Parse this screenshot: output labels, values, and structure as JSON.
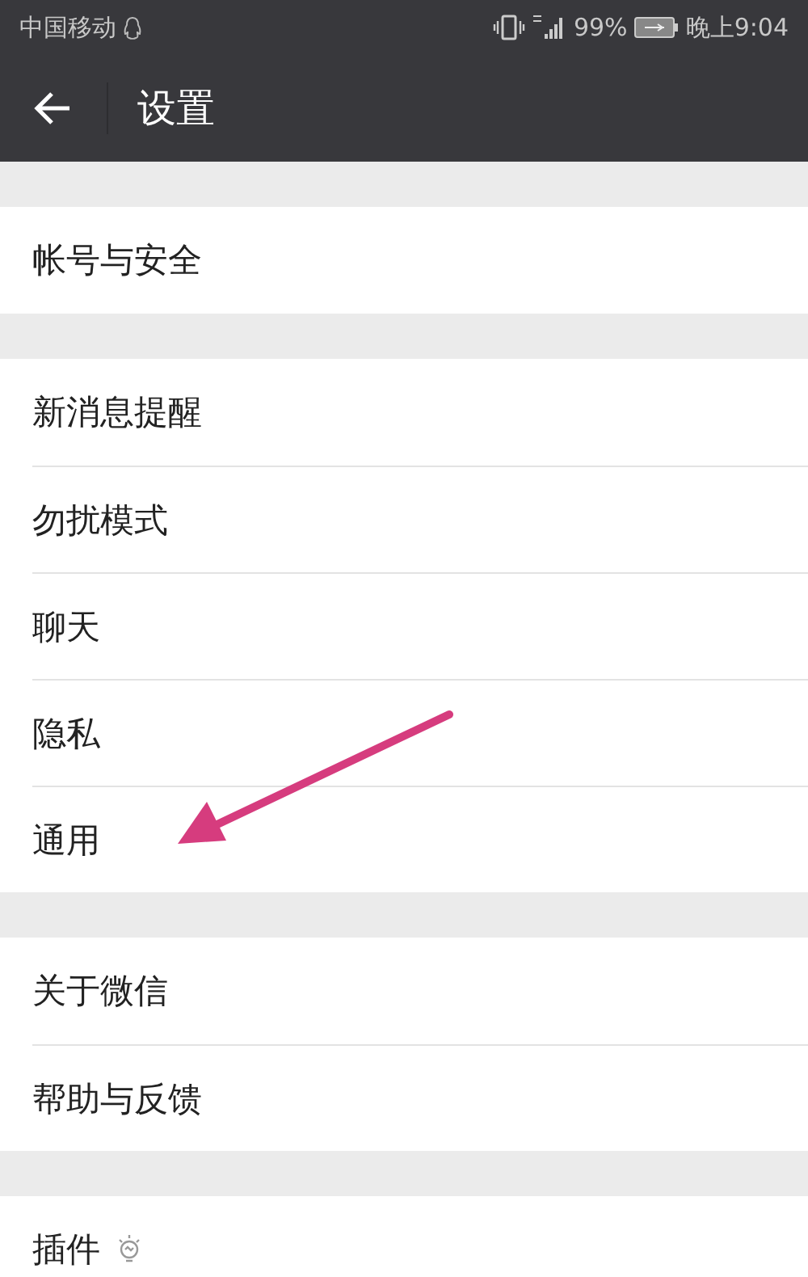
{
  "status_bar": {
    "carrier": "中国移动",
    "battery": "99%",
    "time": "晚上9:04"
  },
  "header": {
    "title": "设置"
  },
  "groups": [
    {
      "items": [
        {
          "label": "帐号与安全",
          "kind": "plain"
        }
      ]
    },
    {
      "items": [
        {
          "label": "新消息提醒",
          "kind": "plain"
        },
        {
          "label": "勿扰模式",
          "kind": "plain"
        },
        {
          "label": "聊天",
          "kind": "plain"
        },
        {
          "label": "隐私",
          "kind": "plain"
        },
        {
          "label": "通用",
          "kind": "plain"
        }
      ]
    },
    {
      "items": [
        {
          "label": "关于微信",
          "kind": "plain"
        },
        {
          "label": "帮助与反馈",
          "kind": "plain"
        }
      ]
    },
    {
      "items": [
        {
          "label": "插件",
          "kind": "bulb"
        }
      ]
    }
  ]
}
